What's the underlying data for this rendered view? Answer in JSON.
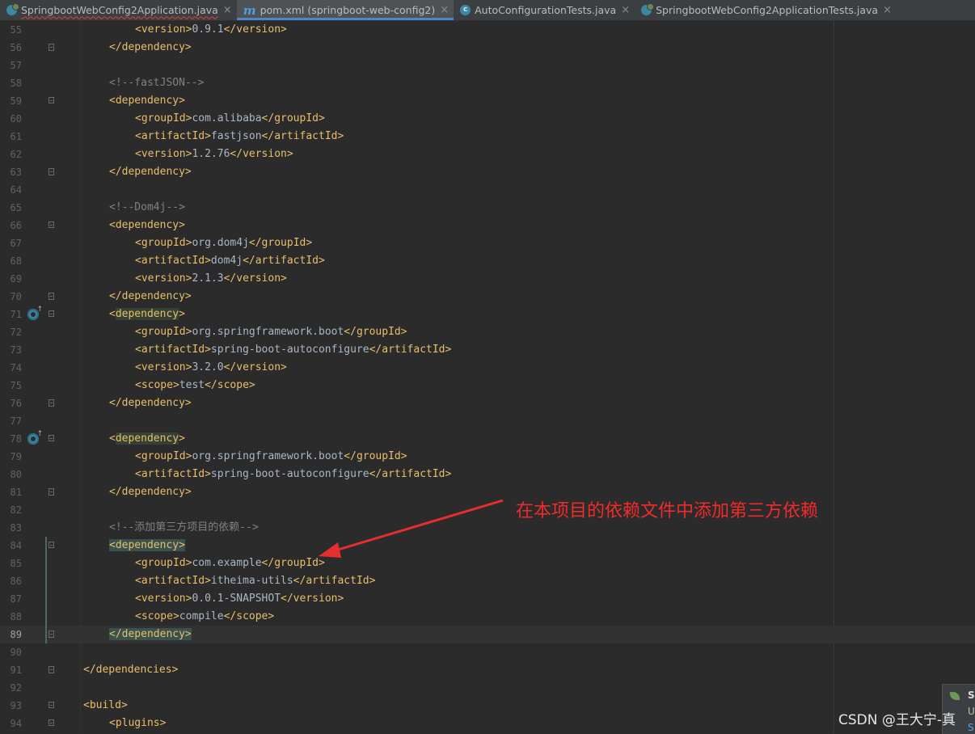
{
  "tabs": [
    {
      "label": "SpringbootWebConfig2Application.java",
      "icon": "spring-boot-app-icon",
      "active": false,
      "error": true
    },
    {
      "label": "pom.xml (springboot-web-config2)",
      "icon": "maven-icon",
      "active": true,
      "error": false
    },
    {
      "label": "AutoConfigurationTests.java",
      "icon": "class-icon",
      "active": false,
      "error": false
    },
    {
      "label": "SpringbootWebConfig2ApplicationTests.java",
      "icon": "spring-boot-test-icon",
      "active": false,
      "error": false
    }
  ],
  "close_glyph": "×",
  "class_icon_letter": "c",
  "maven_glyph": "m",
  "gutter_icon_glyph": "↑",
  "editor": {
    "current_line": 89,
    "lines": [
      {
        "n": "55"
      },
      {
        "n": "56"
      },
      {
        "n": "57"
      },
      {
        "n": "58"
      },
      {
        "n": "59"
      },
      {
        "n": "60"
      },
      {
        "n": "61"
      },
      {
        "n": "62"
      },
      {
        "n": "63"
      },
      {
        "n": "64"
      },
      {
        "n": "65"
      },
      {
        "n": "66"
      },
      {
        "n": "67"
      },
      {
        "n": "68"
      },
      {
        "n": "69"
      },
      {
        "n": "70"
      },
      {
        "n": "71"
      },
      {
        "n": "72"
      },
      {
        "n": "73"
      },
      {
        "n": "74"
      },
      {
        "n": "75"
      },
      {
        "n": "76"
      },
      {
        "n": "77"
      },
      {
        "n": "78"
      },
      {
        "n": "79"
      },
      {
        "n": "80"
      },
      {
        "n": "81"
      },
      {
        "n": "82"
      },
      {
        "n": "83"
      },
      {
        "n": "84"
      },
      {
        "n": "85"
      },
      {
        "n": "86"
      },
      {
        "n": "87"
      },
      {
        "n": "88"
      },
      {
        "n": "89"
      },
      {
        "n": "90"
      },
      {
        "n": "91"
      },
      {
        "n": "92"
      },
      {
        "n": "93"
      },
      {
        "n": "94"
      }
    ],
    "code": {
      "l55_open": "<version>",
      "l55_val": "0.9.1",
      "l55_close": "</version>",
      "l56": "</dependency>",
      "l58": "<!--fastJSON-->",
      "l59": "<dependency>",
      "l60_open": "<groupId>",
      "l60_val": "com.alibaba",
      "l60_close": "</groupId>",
      "l61_open": "<artifactId>",
      "l61_val": "fastjson",
      "l61_close": "</artifactId>",
      "l62_open": "<version>",
      "l62_val": "1.2.76",
      "l62_close": "</version>",
      "l63": "</dependency>",
      "l65": "<!--Dom4j-->",
      "l66": "<dependency>",
      "l67_open": "<groupId>",
      "l67_val": "org.dom4j",
      "l67_close": "</groupId>",
      "l68_open": "<artifactId>",
      "l68_val": "dom4j",
      "l68_close": "</artifactId>",
      "l69_open": "<version>",
      "l69_val": "2.1.3",
      "l69_close": "</version>",
      "l70": "</dependency>",
      "l71_lt": "<",
      "l71_name": "dependency",
      "l71_gt": ">",
      "l72_open": "<groupId>",
      "l72_val": "org.springframework.boot",
      "l72_close": "</groupId>",
      "l73_open": "<artifactId>",
      "l73_val": "spring-boot-autoconfigure",
      "l73_close": "</artifactId>",
      "l74_open": "<version>",
      "l74_val": "3.2.0",
      "l74_close": "</version>",
      "l75_open": "<scope>",
      "l75_val": "test",
      "l75_close": "</scope>",
      "l76": "</dependency>",
      "l78_lt": "<",
      "l78_name": "dependency",
      "l78_gt": ">",
      "l79_open": "<groupId>",
      "l79_val": "org.springframework.boot",
      "l79_close": "</groupId>",
      "l80_open": "<artifactId>",
      "l80_val": "spring-boot-autoconfigure",
      "l80_close": "</artifactId>",
      "l81": "</dependency>",
      "l83": "<!--添加第三方项目的依赖-->",
      "l84": "<dependency>",
      "l85_open": "<groupId>",
      "l85_val": "com.example",
      "l85_close": "</groupId>",
      "l86_open": "<artifactId>",
      "l86_val": "itheima-utils",
      "l86_close": "</artifactId>",
      "l87_open": "<version>",
      "l87_val": "0.0.1-SNAPSHOT",
      "l87_close": "</version>",
      "l88_open": "<scope>",
      "l88_val": "compile",
      "l88_close": "</scope>",
      "l89": "</dependency>",
      "l91": "</dependencies>",
      "l93": "<build>",
      "l94": "<plugins>"
    }
  },
  "annotation": {
    "text": "在本项目的依赖文件中添加第三方依赖",
    "color": "#f02b2b"
  },
  "notification": {
    "title": "Sp",
    "body": "U",
    "link": "S"
  },
  "watermark": "CSDN @王大宁-真",
  "colors": {
    "tag": "#e8bf6a",
    "text": "#a9b7c6",
    "comment": "#808080",
    "background": "#2b2b2b",
    "accent": "#4a88c7"
  }
}
